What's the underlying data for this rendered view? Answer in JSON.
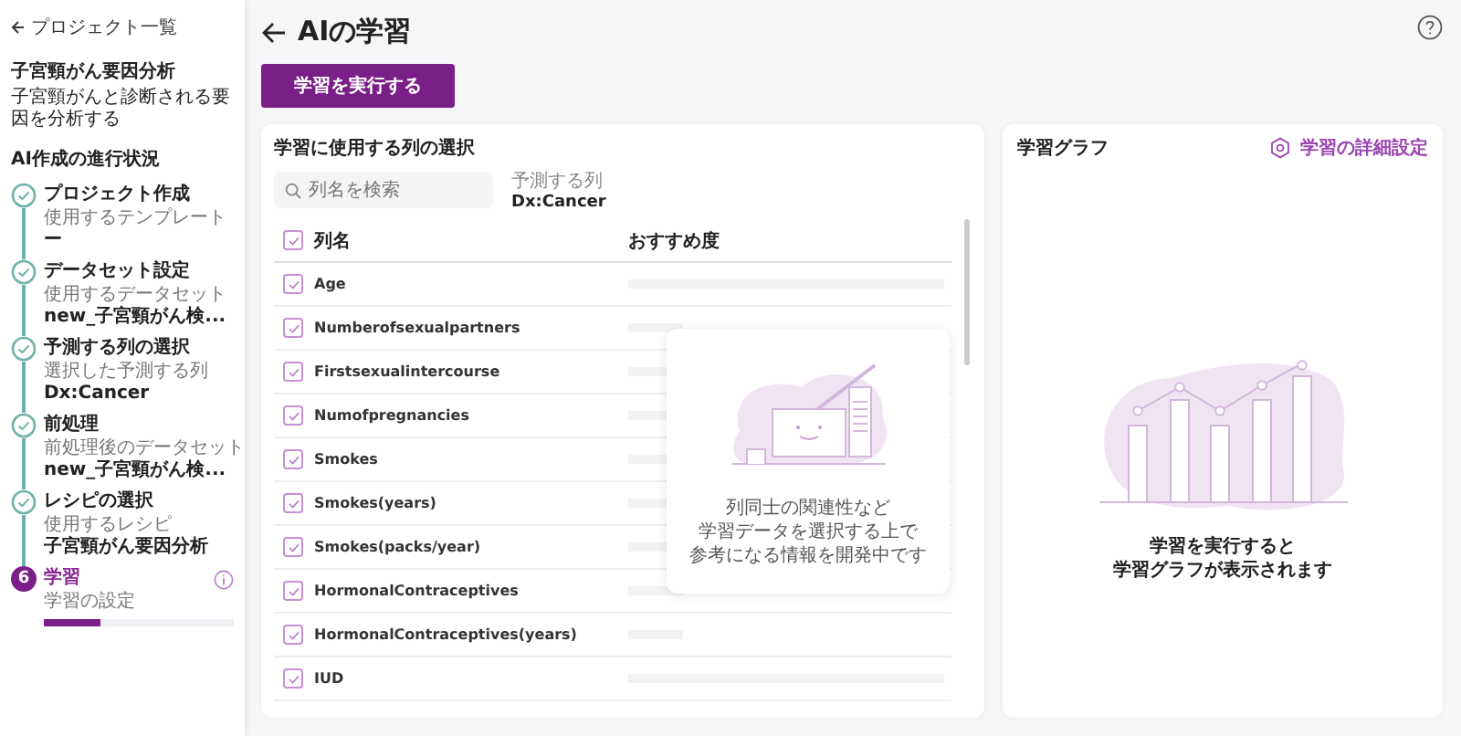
{
  "sidebar": {
    "back_link": "プロジェクト一覧",
    "project_title": "子宮頸がん要因分析",
    "project_description": "子宮頸がんと診断される要因を分析する",
    "progress_heading": "AI作成の進行状況",
    "steps": [
      {
        "title": "プロジェクト作成",
        "sublabel": "使用するテンプレート",
        "value": "ー",
        "completed": true
      },
      {
        "title": "データセット設定",
        "sublabel": "使用するデータセット",
        "value": "new_子宮頸がん検...",
        "completed": true
      },
      {
        "title": "予測する列の選択",
        "sublabel": "選択した予測する列",
        "value": "Dx:Cancer",
        "completed": true
      },
      {
        "title": "前処理",
        "sublabel": "前処理後のデータセット",
        "value": "new_子宮頸がん検...",
        "completed": true
      },
      {
        "title": "レシピの選択",
        "sublabel": "使用するレシピ",
        "value": "子宮頸がん要因分析",
        "completed": true
      },
      {
        "title": "学習",
        "sublabel": "学習の設定",
        "number": "6",
        "completed": false,
        "level": 0.3
      }
    ]
  },
  "header": {
    "title": "AIの学習",
    "run_button": "学習を実行する"
  },
  "columns_panel": {
    "title": "学習に使用する列の選択",
    "search": {
      "placeholder": "列名を検索"
    },
    "target_label": "予測する列",
    "target_value": "Dx:Cancer",
    "table": {
      "all_checked": true,
      "columns": [
        "列名",
        "おすすめ度"
      ],
      "rows": [
        {
          "name": "Age",
          "checked": true
        },
        {
          "name": "Numberofsexualpartners",
          "checked": true
        },
        {
          "name": "Firstsexualintercourse",
          "checked": true
        },
        {
          "name": "Numofpregnancies",
          "checked": true
        },
        {
          "name": "Smokes",
          "checked": true
        },
        {
          "name": "Smokes(years)",
          "checked": true
        },
        {
          "name": "Smokes(packs/year)",
          "checked": true
        },
        {
          "name": "HormonalContraceptives",
          "checked": true
        },
        {
          "name": "HormonalContraceptives(years)",
          "checked": true
        },
        {
          "name": "IUD",
          "checked": true
        }
      ]
    },
    "notice": [
      "列同士の関連性など",
      "学習データを選択する上で",
      "参考になる情報を開発中です"
    ]
  },
  "graph_panel": {
    "title": "学習グラフ",
    "settings_link": "学習の詳細設定",
    "empty_message": [
      "学習を実行すると",
      "学習グラフが表示されます"
    ]
  }
}
